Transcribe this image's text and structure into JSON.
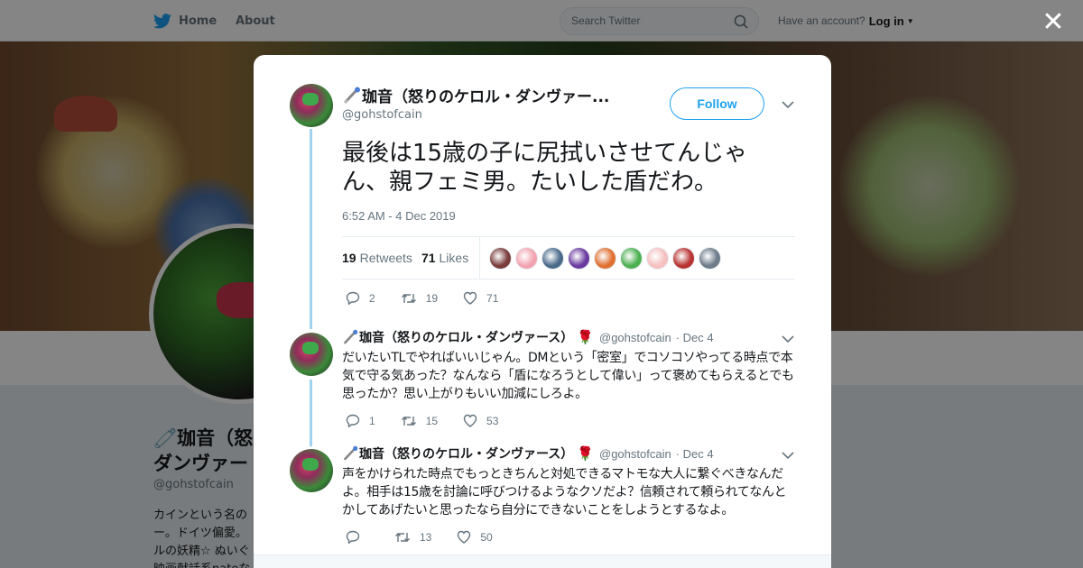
{
  "topbar": {
    "home_label": "Home",
    "about_label": "About",
    "search_placeholder": "Search Twitter",
    "have_account": "Have an account?",
    "login_label": "Log in"
  },
  "profile": {
    "name_line1": "🧷珈音（怒",
    "name_line2": "ダンヴァー",
    "handle": "@gohstofcain",
    "bio": "カインという名の\nー。ドイツ偏愛。\nルの妖精☆ ぬいぐ\n映画献話系nateな"
  },
  "tweet": {
    "name": "珈音（怒りのケロル・ダンヴァー...",
    "handle": "@gohstofcain",
    "follow_label": "Follow",
    "text": "最後は15歳の子に尻拭いさせてんじゃん、親フェミ男。たいした盾だわ。",
    "timestamp": "6:52 AM - 4 Dec 2019",
    "retweets_count": "19",
    "retweets_label": "Retweets",
    "likes_count": "71",
    "likes_label": "Likes",
    "replies": "2",
    "retweets": "19",
    "likes": "71"
  },
  "likers": [
    "#7a3b3b",
    "#f2a3b0",
    "#4a6a8a",
    "#6a3aa0",
    "#e07030",
    "#4caf50",
    "#f5c0c0",
    "#b83232",
    "#6c7a89"
  ],
  "replies": [
    {
      "name": "珈音（怒りのケロル・ダンヴァース）",
      "rose": "🌹",
      "handle": "@gohstofcain",
      "date": "· Dec 4",
      "text": "だいたいTLでやればいいじゃん。DMという「密室」でコソコソやってる時点で本気で守る気あった？なんなら「盾になろうとして偉い」って褒めてもらえるとでも思ったか？思い上がりもいい加減にしろよ。",
      "replies": "1",
      "retweets": "15",
      "likes": "53"
    },
    {
      "name": "珈音（怒りのケロル・ダンヴァース）",
      "rose": "🌹",
      "handle": "@gohstofcain",
      "date": "· Dec 4",
      "text": "声をかけられた時点でもっときちんと対処できるマトモな大人に繋ぐべきなんだよ。相手は15歳を討論に呼びつけるようなクソだよ？信頼されて頼られてなんとかしてあげたいと思ったなら自分にできないことをしようとするなよ。",
      "replies": "",
      "retweets": "13",
      "likes": "50"
    }
  ],
  "close_label": "✕"
}
